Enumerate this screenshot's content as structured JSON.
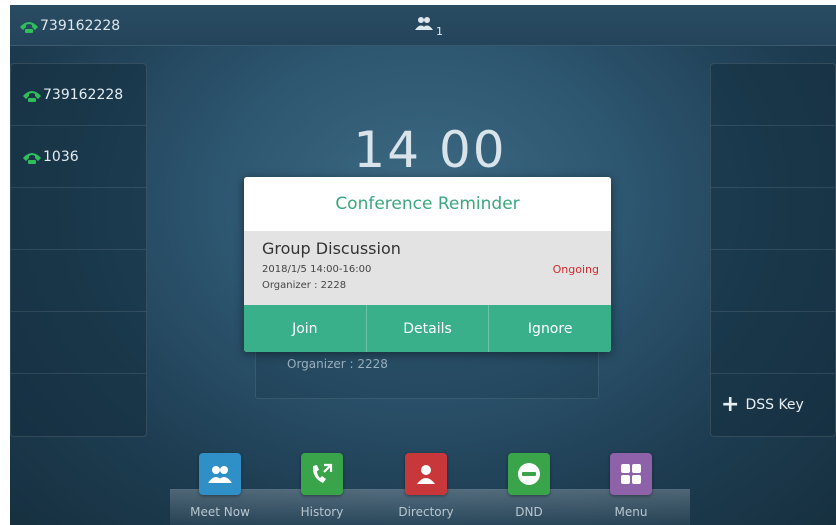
{
  "status_bar": {
    "account_number": "739162228",
    "conference_count": "1"
  },
  "lines": [
    {
      "label": "739162228",
      "icon": "phone-line-icon"
    },
    {
      "label": "1036",
      "icon": "phone-line-icon"
    }
  ],
  "clock": {
    "time": "14 00"
  },
  "dss_key": {
    "label": "DSS Key"
  },
  "background_event": {
    "organizer": "Organizer : 2228"
  },
  "dialog": {
    "title": "Conference Reminder",
    "subject": "Group Discussion",
    "time": "2018/1/5 14:00-16:00",
    "organizer": "Organizer : 2228",
    "status": "Ongoing",
    "actions": {
      "join": "Join",
      "details": "Details",
      "ignore": "Ignore"
    }
  },
  "softkeys": [
    {
      "label": "Meet Now",
      "icon": "meet-now-icon",
      "color": "#2f8fc7"
    },
    {
      "label": "History",
      "icon": "history-icon",
      "color": "#3aa44a"
    },
    {
      "label": "Directory",
      "icon": "directory-icon",
      "color": "#c8383a"
    },
    {
      "label": "DND",
      "icon": "dnd-icon",
      "color": "#3aa44a"
    },
    {
      "label": "Menu",
      "icon": "menu-icon",
      "color": "#8e62a8"
    }
  ],
  "colors": {
    "accent_green": "#3ab08a",
    "status_red": "#d42b2b",
    "phone_icon_green": "#2fbf5a"
  }
}
